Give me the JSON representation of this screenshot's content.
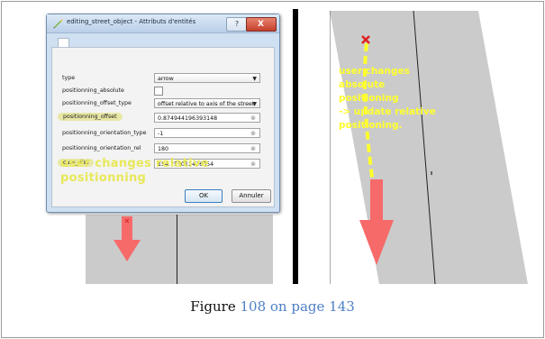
{
  "dialog": {
    "title": "editing_street_object - Attributs d'entités",
    "help": "?",
    "close": "X",
    "fields": [
      {
        "label": "type",
        "value": "arrow",
        "kind": "combo"
      },
      {
        "label": "positionning_absolute",
        "value": "",
        "kind": "checkbox"
      },
      {
        "label": "positionning_offset_type",
        "value": "offset relative to axis of the street",
        "kind": "combo"
      },
      {
        "label": "positionning_offset",
        "value": "0.874944196393148",
        "kind": "text"
      },
      {
        "label": "positionning_orientation_type",
        "value": "-1",
        "kind": "text"
      },
      {
        "label": "positionning_orientation_rel",
        "value": "180",
        "kind": "text"
      },
      {
        "label": "curv_dist",
        "value": "154.751012416354",
        "kind": "text"
      }
    ],
    "highlighted": [
      "positionning_offset",
      "curv_dist"
    ],
    "overlay_line1": "user changes relative",
    "overlay_line2": "positionning",
    "ok": "OK",
    "cancel": "Annuler"
  },
  "right_annotation": {
    "line1": "user changes",
    "line2": "absolute",
    "line3": "positioning",
    "line4": "-> update relative",
    "line5": "positioning."
  },
  "caption": {
    "prefix": "Figure ",
    "link": "108 on page 143"
  },
  "colors": {
    "annotation_yellow": "#ffff2e",
    "arrow_red": "#f76a6a",
    "road_gray": "#cbcbcb",
    "link_blue": "#4d7fc6"
  }
}
